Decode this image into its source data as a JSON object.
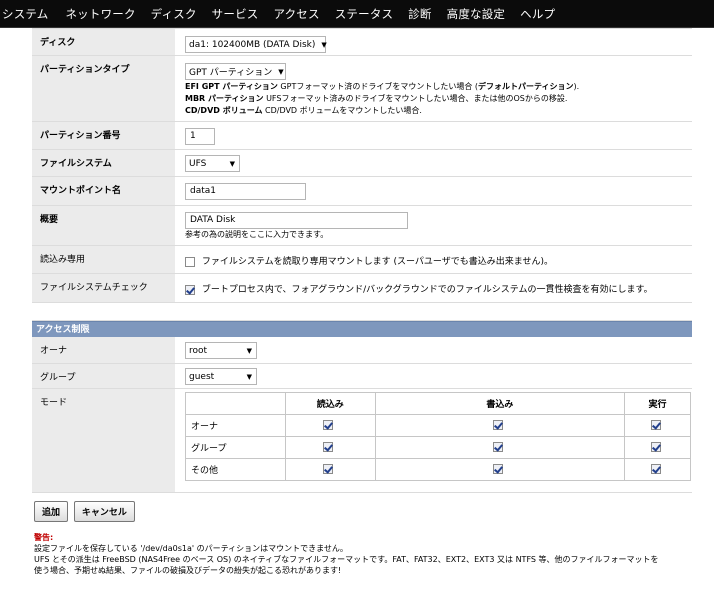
{
  "nav": {
    "items": [
      "システム",
      "ネットワーク",
      "ディスク",
      "サービス",
      "アクセス",
      "ステータス",
      "診断",
      "高度な設定",
      "ヘルプ"
    ]
  },
  "form": {
    "disk": {
      "label": "ディスク",
      "value": "da1: 102400MB (DATA Disk)"
    },
    "partition_type": {
      "label": "パーティションタイプ",
      "value": "GPT パーティション",
      "desc1_bold": "EFI GPT パーティション",
      "desc1_text": " GPTフォーマット済のドライブをマウントしたい場合 (",
      "desc1_bold2": "デフォルトパーティション",
      "desc1_end": ").",
      "desc2_bold": "MBR パーティション",
      "desc2_text": " UFSフォーマット済みのドライブをマウントしたい場合、または他のOSからの移設.",
      "desc3_bold": "CD/DVD ボリューム",
      "desc3_text": " CD/DVD ボリュームをマウントしたい場合."
    },
    "partition_number": {
      "label": "パーティション番号",
      "value": "1"
    },
    "filesystem": {
      "label": "ファイルシステム",
      "value": "UFS"
    },
    "mountpoint": {
      "label": "マウントポイント名",
      "value": "data1"
    },
    "description": {
      "label": "概要",
      "value": "DATA Disk",
      "hint": "参考の為の説明をここに入力できます。"
    },
    "readonly": {
      "label": "読込み専用",
      "text": "ファイルシステムを読取り専用マウントします (スーパユーザでも書込み出来ません)。",
      "checked": false
    },
    "fsck": {
      "label": "ファイルシステムチェック",
      "text": "ブートプロセス内で、フォアグラウンド/バックグラウンドでのファイルシステムの一貫性検査を有効にします。",
      "checked": true
    }
  },
  "access": {
    "section_title": "アクセス制限",
    "owner": {
      "label": "オーナ",
      "value": "root"
    },
    "group": {
      "label": "グループ",
      "value": "guest"
    },
    "mode": {
      "label": "モード",
      "headers": [
        "",
        "読込み",
        "書込み",
        "実行"
      ],
      "rows": [
        {
          "name": "オーナ",
          "read": true,
          "write": true,
          "exec": true
        },
        {
          "name": "グループ",
          "read": true,
          "write": true,
          "exec": true
        },
        {
          "name": "その他",
          "read": true,
          "write": true,
          "exec": true
        }
      ]
    }
  },
  "buttons": {
    "add": "追加",
    "cancel": "キャンセル"
  },
  "warning": {
    "title": "警告:",
    "line1": "設定ファイルを保存している '/dev/da0s1a' のパーティションはマウントできません。",
    "line2": "UFS とその派生は FreeBSD (NAS4Free のベース OS) のネイティブなファイルフォーマットです。FAT、FAT32、EXT2、EXT3 又は NTFS 等、他のファイルフォーマットを",
    "line3": "使う場合、予期せぬ結果、ファイルの破損及びデータの紛失が起こる恐れがあります!"
  }
}
